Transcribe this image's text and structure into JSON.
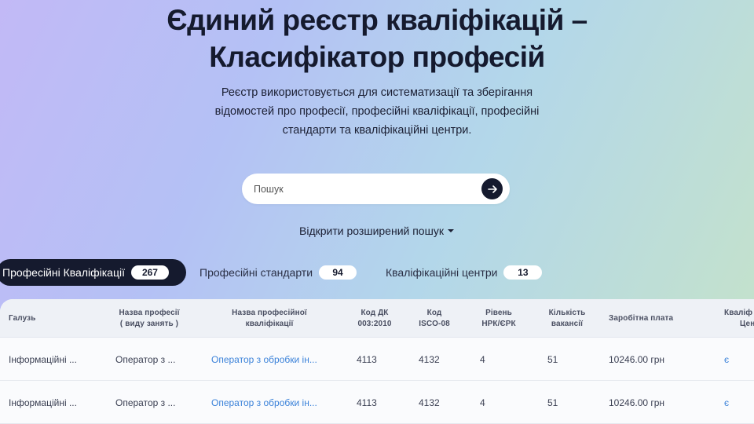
{
  "hero": {
    "title_line1": "Єдиний реєстр кваліфікацій –",
    "title_line2": "Класифікатор професій",
    "subtitle": "Реєстр використовується для систематизації та зберігання відомостей про професії, професійні кваліфікації, професійні стандарти та кваліфікаційні центри."
  },
  "search": {
    "placeholder": "Пошук",
    "button_icon": "arrow-right-icon"
  },
  "advanced_search": {
    "label": "Відкрити розширений пошук",
    "icon": "caret-down-icon"
  },
  "tabs": [
    {
      "label": "Професійні Кваліфікації",
      "count": "267",
      "active": true
    },
    {
      "label": "Професійні стандарти",
      "count": "94",
      "active": false
    },
    {
      "label": "Кваліфікаційні центри",
      "count": "13",
      "active": false
    }
  ],
  "table": {
    "headers": {
      "industry": "Галузь",
      "profession_l1": "Назва професії",
      "profession_l2": "( виду занять )",
      "qualification_l1": "Назва професійної",
      "qualification_l2": "кваліфікації",
      "dk_l1": "Код ДК",
      "dk_l2": "003:2010",
      "isco_l1": "Код",
      "isco_l2": "ISCO-08",
      "level_l1": "Рівень",
      "level_l2": "НРК/ЄРК",
      "vacancies_l1": "Кількість",
      "vacancies_l2": "вакансії",
      "salary": "Заробітна плата",
      "center_l1": "Кваліф",
      "center_l2": "Цен"
    },
    "rows": [
      {
        "industry": "Інформаційні ...",
        "profession": "Оператор з ...",
        "qualification": "Оператор з обробки ін...",
        "dk": "4113",
        "isco": "4132",
        "level": "4",
        "vacancies": "51",
        "salary": "10246.00 грн",
        "center": "є"
      },
      {
        "industry": "Інформаційні ...",
        "profession": "Оператор з ...",
        "qualification": "Оператор з обробки ін...",
        "dk": "4113",
        "isco": "4132",
        "level": "4",
        "vacancies": "51",
        "salary": "10246.00 грн",
        "center": "є"
      }
    ]
  },
  "colors": {
    "dark": "#151a2e",
    "link": "#3b82d9"
  }
}
